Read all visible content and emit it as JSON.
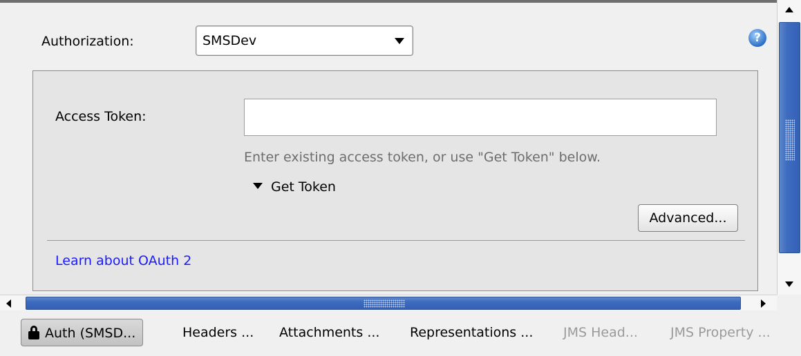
{
  "authorization": {
    "label": "Authorization:",
    "selected": "SMSDev",
    "help_icon": "help-icon",
    "help_glyph": "?"
  },
  "oauth": {
    "access_token_label": "Access Token:",
    "access_token_value": "",
    "hint": "Enter existing access token, or use \"Get Token\" below.",
    "get_token_label": "Get Token",
    "advanced_label": "Advanced...",
    "learn_link": "Learn about OAuth 2"
  },
  "tabs": [
    {
      "label": "Auth (SMSD...",
      "active": true,
      "icon": "lock-icon"
    },
    {
      "label": "Headers ...",
      "active": false
    },
    {
      "label": "Attachments ...",
      "active": false
    },
    {
      "label": "Representations ...",
      "active": false
    },
    {
      "label": "JMS Head...",
      "active": false,
      "disabled": true
    },
    {
      "label": "JMS Property ...",
      "active": false,
      "disabled": true
    }
  ]
}
